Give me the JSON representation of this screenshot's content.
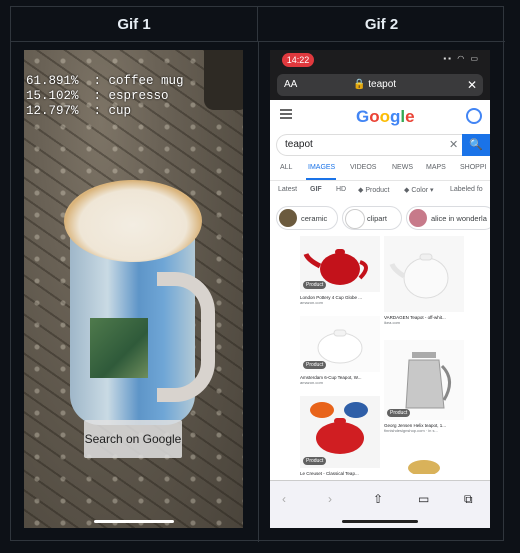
{
  "headers": {
    "gif1": "Gif 1",
    "gif2": "Gif 2"
  },
  "gif1": {
    "predictions": [
      "61.891%  : coffee mug",
      "15.102%  : espresso",
      "12.797%  : cup"
    ],
    "search_button": "Search on Google"
  },
  "gif2": {
    "status_time": "14:22",
    "url_aa": "AA",
    "url_query": "🔒 teapot",
    "url_close": "✕",
    "logo": [
      "G",
      "o",
      "o",
      "g",
      "l",
      "e"
    ],
    "search_value": "teapot",
    "search_clear": "✕",
    "search_icon": "🔍",
    "tabs": [
      "ALL",
      "IMAGES",
      "VIDEOS",
      "NEWS",
      "MAPS",
      "SHOPPI"
    ],
    "filters": [
      "Latest",
      "GIF",
      "HD",
      "◆ Product",
      "◆ Color ▾",
      "Labeled fo"
    ],
    "chips": [
      "ceramic",
      "clipart",
      "alice in wonderla"
    ],
    "results": [
      {
        "title": "London Pottery 4 Cup Globe ...",
        "domain": "amazon.com",
        "badge": "Product"
      },
      {
        "title": "VARDAGEN Teapot - off-whit...",
        "domain": "ikea.com",
        "badge": ""
      },
      {
        "title": "Amsterdam 6-Cup Teapot, W...",
        "domain": "amazon.com",
        "badge": "Product"
      },
      {
        "title": "Georg Jensen Helix teapot, 1...",
        "domain": "finnishdesignshop.com · in s...",
        "badge": "Product"
      },
      {
        "title": "Le Creuset - Classical Teap...",
        "domain": "",
        "badge": "Product"
      }
    ],
    "nav": [
      "‹",
      "›",
      "⇧",
      "▭",
      "⧉"
    ]
  }
}
